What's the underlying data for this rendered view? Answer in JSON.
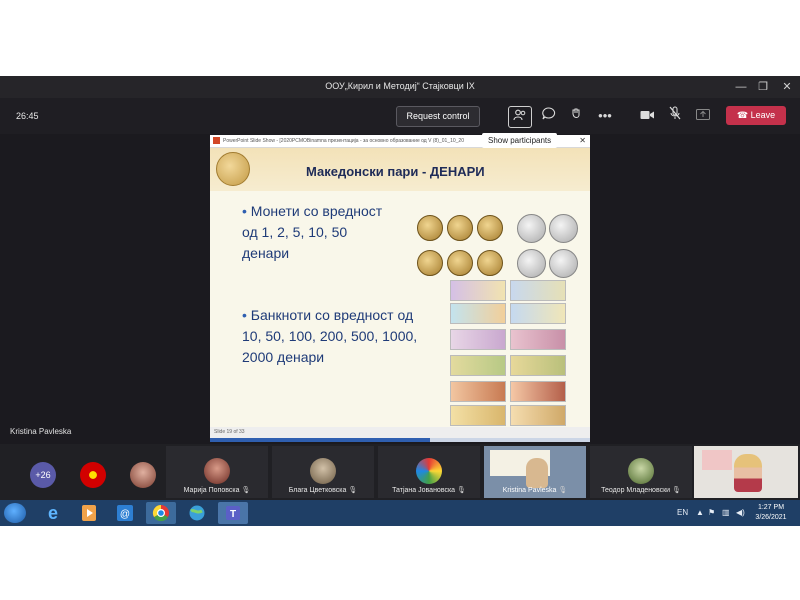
{
  "window": {
    "title": "ООУ„Кирил и Методиј“ Стајковци IX",
    "minimize": "—",
    "restore": "❐",
    "close": "✕"
  },
  "toolbar": {
    "timer": "26:45",
    "request_control": "Request control",
    "leave": "Leave",
    "tooltip": "Show participants"
  },
  "slide": {
    "ppt_bar": "PowerPoint Slide Show - [2020PCMOBinamna презентација - за основно образование од V (8)_01_10_20",
    "title": "Македонски пари - ДЕНАРИ",
    "bullet1": [
      "Монети со вредност",
      "од 1, 2, 5, 10, 50",
      "денари"
    ],
    "bullet2": [
      "Банкноти со вредност од",
      "10, 50, 100, 200, 500, 1000,",
      "2000 денари"
    ],
    "status": "Slide 19 of 33",
    "progress": 0.58
  },
  "presenter": "Kristina Pavleska",
  "gallery": {
    "overflow_count": "+26",
    "participants": [
      {
        "name": "Марија Поповска"
      },
      {
        "name": "Блага Цветковска"
      },
      {
        "name": "Татјана Јовановска"
      },
      {
        "name": "Kristina Pavleska"
      },
      {
        "name": "Теодор Младеновски"
      }
    ]
  },
  "taskbar": {
    "lang": "EN",
    "time": "1:27 PM",
    "date": "3/26/2021"
  },
  "colors": {
    "teams_bg": "#1b1a1f",
    "leave_red": "#c4314b",
    "slide_title": "#1e2b58",
    "slide_text": "#1f3b78",
    "taskbar": "#1f3f66"
  }
}
